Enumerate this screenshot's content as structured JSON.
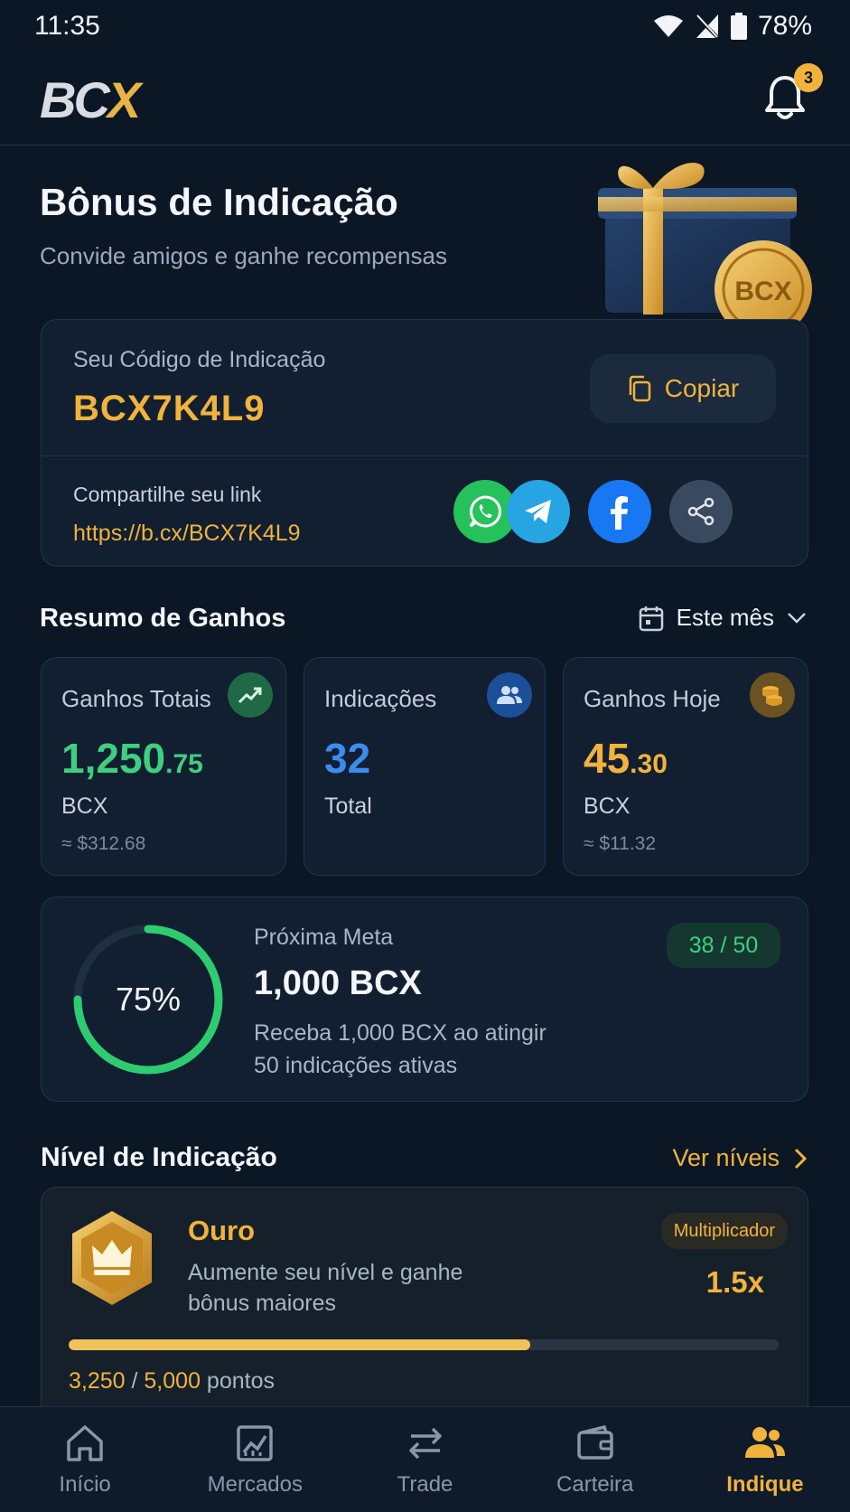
{
  "status_bar": {
    "time": "11:35",
    "battery": "78%"
  },
  "header": {
    "logo_left": "BC",
    "logo_accent": "X",
    "notification_count": "3"
  },
  "hero": {
    "title": "Bônus de Indicação",
    "subtitle": "Convide amigos e ganhe recompensas",
    "gift_coin_label": "BCX"
  },
  "referral": {
    "code_label": "Seu Código de Indicação",
    "code": "BCX7K4L9",
    "copy_label": "Copiar",
    "share_label": "Compartilhe seu link",
    "link": "https://b.cx/BCX7K4L9",
    "share_icons": [
      "whatsapp-icon",
      "telegram-icon",
      "facebook-icon",
      "share-icon"
    ]
  },
  "summary": {
    "title": "Resumo de Ganhos",
    "period": "Este mês",
    "stats": [
      {
        "label": "Ganhos Totais",
        "value_int": "1,250",
        "value_dec": ".75",
        "unit": "BCX",
        "usd": "≈ $312.68",
        "icon": "trending-up-icon",
        "color": "#3fcf7f"
      },
      {
        "label": "Indicações",
        "value_int": "32",
        "value_dec": "",
        "unit": "Total",
        "usd": "",
        "icon": "users-icon",
        "color": "#3b8cf0"
      },
      {
        "label": "Ganhos Hoje",
        "value_int": "45",
        "value_dec": ".30",
        "unit": "BCX",
        "usd": "≈ $11.32",
        "icon": "coins-icon",
        "color": "#f1b33c"
      }
    ]
  },
  "goal": {
    "percent_label": "75%",
    "progress": 0.75,
    "label": "Próxima Meta",
    "value": "1,000 BCX",
    "desc_line1": "Receba 1,000 BCX ao atingir",
    "desc_line2": "50 indicações ativas",
    "badge": "38 / 50"
  },
  "level": {
    "title": "Nível de Indicação",
    "see_all": "Ver níveis",
    "name": "Ouro",
    "desc_line1": "Aumente seu nível e ganhe",
    "desc_line2": "bônus maiores",
    "multiplier_label": "Multiplicador",
    "multiplier": "1.5x",
    "points_current": "3,250",
    "points_sep": " / ",
    "points_target": "5,000",
    "points_unit": " pontos",
    "progress": 0.65
  },
  "nav": {
    "items": [
      {
        "label": "Início",
        "icon": "home-icon"
      },
      {
        "label": "Mercados",
        "icon": "chart-icon"
      },
      {
        "label": "Trade",
        "icon": "swap-icon"
      },
      {
        "label": "Carteira",
        "icon": "wallet-icon"
      },
      {
        "label": "Indique",
        "icon": "users-icon"
      }
    ],
    "active": "Indique"
  }
}
